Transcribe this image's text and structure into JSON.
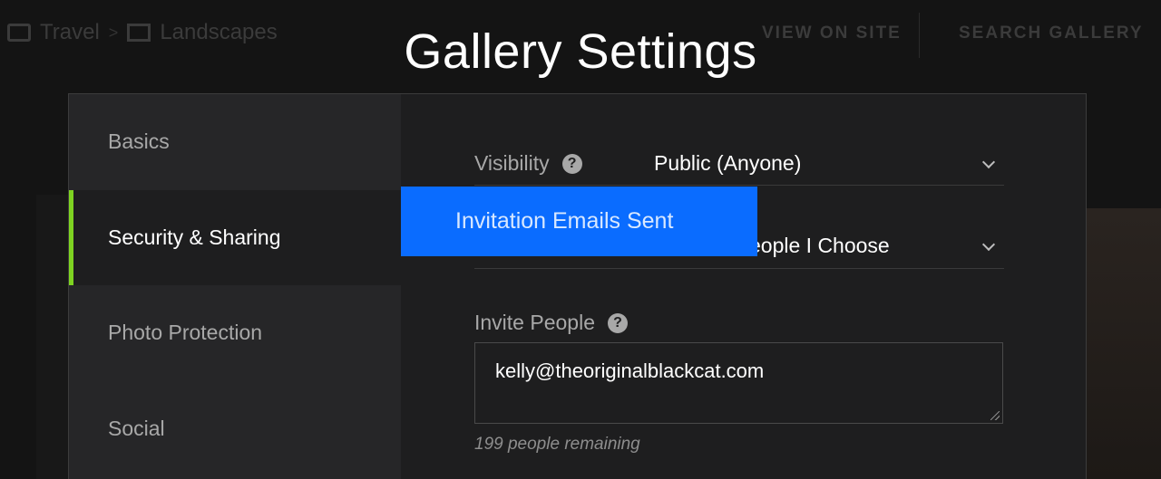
{
  "background": {
    "breadcrumb": {
      "item1": "Travel",
      "separator": ">",
      "item2": "Landscapes"
    },
    "view_on_site": "VIEW ON SITE",
    "search_gallery": "SEARCH GALLERY"
  },
  "modal": {
    "title": "Gallery Settings",
    "sidebar": {
      "items": [
        {
          "label": "Basics"
        },
        {
          "label": "Security & Sharing"
        },
        {
          "label": "Photo Protection"
        },
        {
          "label": "Social"
        }
      ],
      "active_index": 1
    },
    "visibility": {
      "label": "Visibility",
      "value": "Public (Anyone)"
    },
    "access": {
      "value_visible": "eople I Choose"
    },
    "invite": {
      "label": "Invite People",
      "value": "kelly@theoriginalblackcat.com",
      "remaining": "199 people remaining"
    }
  },
  "toast": {
    "message": "Invitation Emails Sent"
  },
  "colors": {
    "accent": "#7ed321",
    "toast": "#0a6cff"
  },
  "icons": [
    "folder-icon",
    "gallery-icon",
    "help-icon",
    "chevron-down-icon",
    "resize-handle-icon"
  ]
}
